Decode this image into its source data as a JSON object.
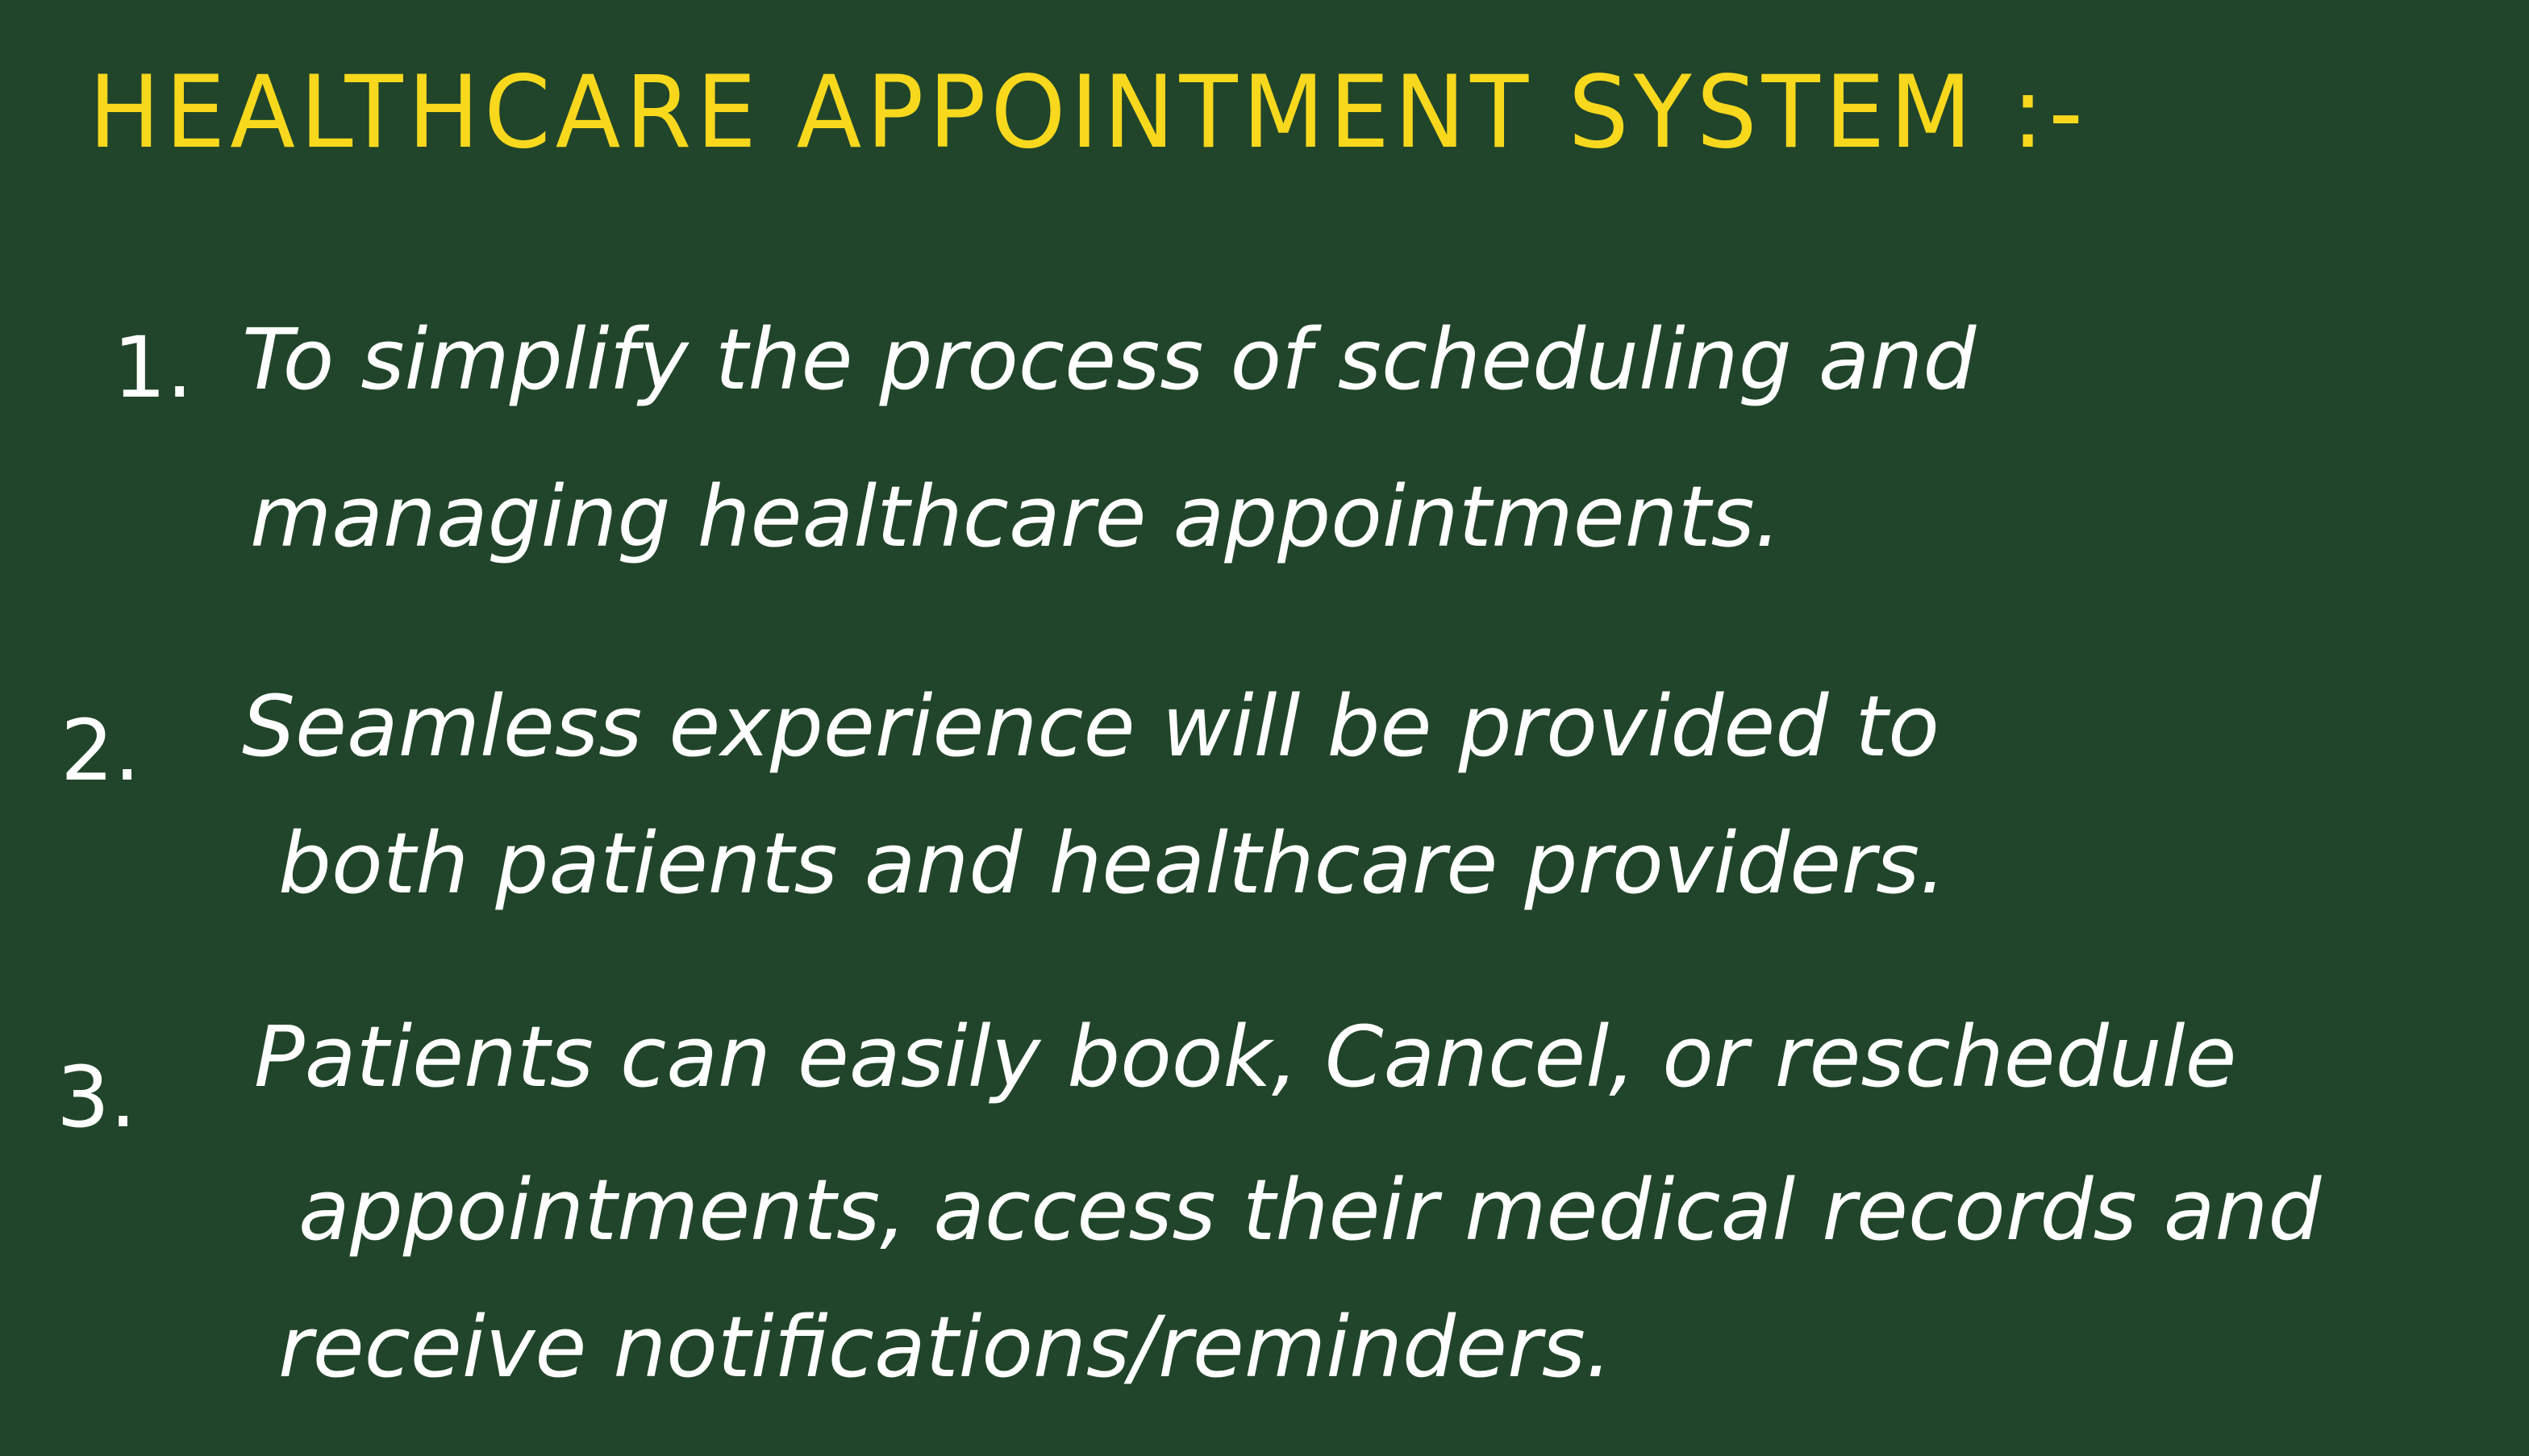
{
  "title": "HEALTHCARE APPOINTMENT SYSTEM :-",
  "colors": {
    "background": "#21452a",
    "title": "#f7d81d",
    "text": "#ffffff"
  },
  "points": [
    {
      "number": "1.",
      "lines": [
        "To simplify the process of scheduling and",
        "managing healthcare appointments."
      ]
    },
    {
      "number": "2.",
      "lines": [
        "Seamless experience will be provided to",
        "both patients and healthcare providers."
      ]
    },
    {
      "number": "3.",
      "lines": [
        "Patients can easily book, Cancel, or reschedule",
        "appointments, access their medical records and",
        "receive notifications/reminders."
      ]
    }
  ]
}
